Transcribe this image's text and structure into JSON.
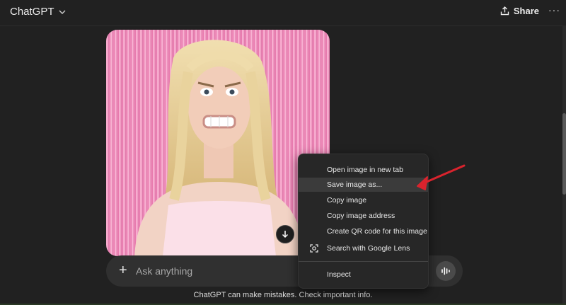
{
  "header": {
    "title": "ChatGPT",
    "share_label": "Share",
    "more_label": "···"
  },
  "composer": {
    "placeholder": "Ask anything"
  },
  "disclaimer": "ChatGPT can make mistakes. Check important info.",
  "context_menu": {
    "items": [
      {
        "label": "Open image in new tab"
      },
      {
        "label": "Save image as..."
      },
      {
        "label": "Copy image"
      },
      {
        "label": "Copy image address"
      },
      {
        "label": "Create QR code for this image"
      },
      {
        "label": "Search with Google Lens"
      },
      {
        "label": "Inspect"
      }
    ],
    "hovered_item": "Save image as..."
  },
  "colors": {
    "background": "#212121",
    "annotation_arrow": "#d9232d"
  }
}
